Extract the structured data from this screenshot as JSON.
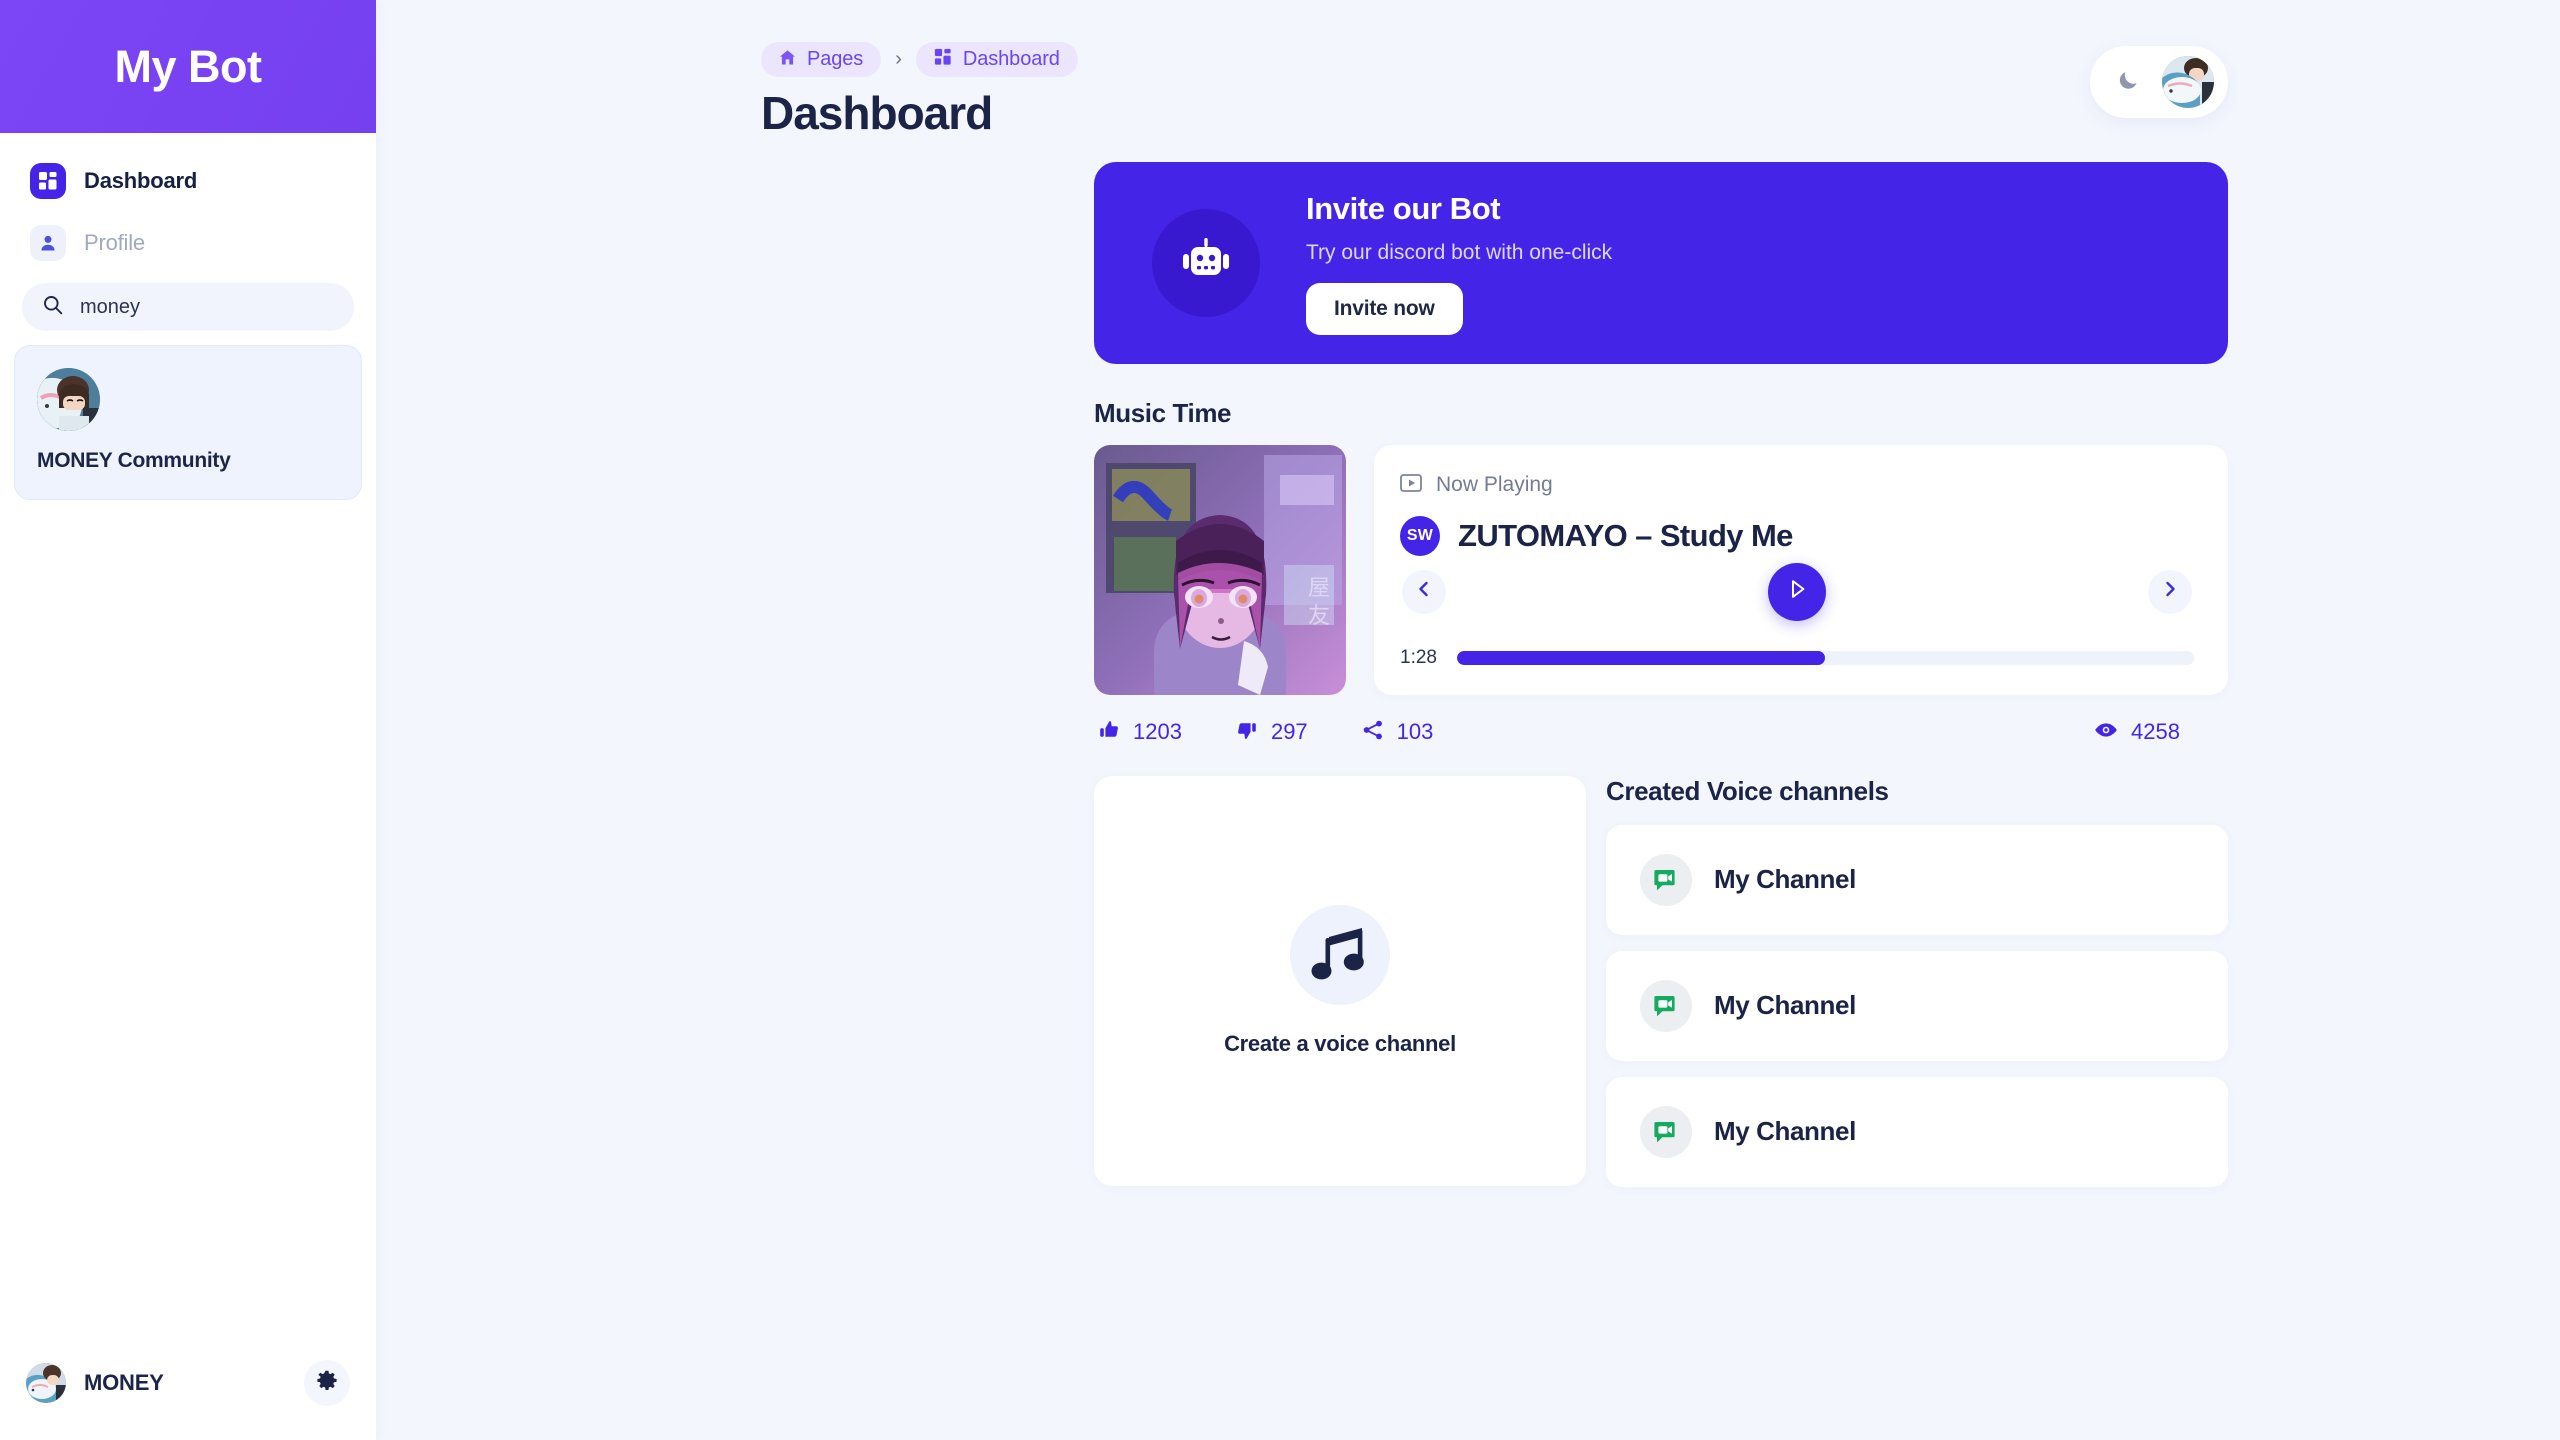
{
  "sidebar": {
    "brand": "My Bot",
    "nav": [
      {
        "label": "Dashboard",
        "icon": "grid-icon",
        "active": true
      },
      {
        "label": "Profile",
        "icon": "user-icon",
        "active": false
      }
    ],
    "search": {
      "value": "money",
      "placeholder": "Search",
      "icon": "search-icon"
    },
    "guild": {
      "name": "MONEY Community"
    },
    "footer": {
      "name": "MONEY",
      "settings_icon": "gear-icon"
    }
  },
  "header": {
    "breadcrumb": [
      {
        "label": "Pages",
        "icon": "home-icon"
      },
      {
        "label": "Dashboard",
        "icon": "grid-icon"
      }
    ],
    "separator": "›",
    "title": "Dashboard",
    "theme_toggle_icon": "moon-icon"
  },
  "invite": {
    "icon": "robot-icon",
    "title": "Invite our Bot",
    "subtitle": "Try our discord bot with one-click",
    "button": "Invite now"
  },
  "music": {
    "section_title": "Music Time",
    "now_playing_label": "Now Playing",
    "now_playing_icon": "play-box-icon",
    "source_badge": "SW",
    "track_title": "ZUTOMAYO – Study Me",
    "prev_icon": "chevron-left-icon",
    "play_icon": "play-icon",
    "next_icon": "chevron-right-icon",
    "current_time": "1:28",
    "progress_percent": 50,
    "stats": [
      {
        "icon": "thumbs-up-icon",
        "value": "1203"
      },
      {
        "icon": "thumbs-down-icon",
        "value": "297"
      },
      {
        "icon": "share-icon",
        "value": "103"
      }
    ],
    "views": {
      "icon": "eye-icon",
      "value": "4258"
    }
  },
  "voice": {
    "create_label": "Create a voice channel",
    "create_icon": "music-note-icon",
    "heading": "Created Voice channels",
    "channels": [
      {
        "name": "My Channel",
        "icon": "video-chat-icon"
      },
      {
        "name": "My Channel",
        "icon": "video-chat-icon"
      },
      {
        "name": "My Channel",
        "icon": "video-chat-icon"
      }
    ]
  },
  "colors": {
    "brand_purple": "#7C4DFF",
    "accent": "#4425e8",
    "background": "#f4f6fe",
    "text_dark": "#1b2346",
    "green": "#14ab60"
  }
}
